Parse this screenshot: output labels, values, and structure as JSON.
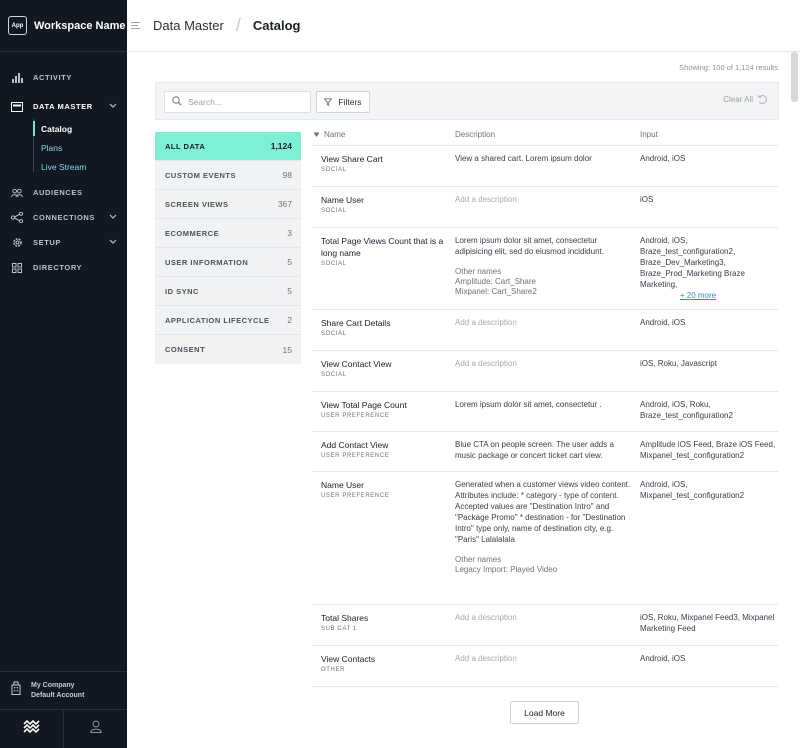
{
  "workspace": {
    "logo_text": "App",
    "name": "Workspace Name"
  },
  "nav": {
    "activity": "ACTIVITY",
    "data_master": "DATA MASTER",
    "sub": [
      "Catalog",
      "Plans",
      "Live Stream"
    ],
    "audiences": "AUDIENCES",
    "connections": "CONNECTIONS",
    "setup": "SETUP",
    "directory": "DIRECTORY"
  },
  "company": {
    "line1": "My Company",
    "line2": "Default Account"
  },
  "breadcrumb": {
    "parent": "Data Master",
    "current": "Catalog"
  },
  "showing": "Showing: 100 of 1,124 results",
  "search": {
    "placeholder": "Search..."
  },
  "filters_label": "Filters",
  "clear_all": "Clear All",
  "categories": [
    {
      "label": "ALL DATA",
      "count": "1,124"
    },
    {
      "label": "CUSTOM EVENTS",
      "count": "98"
    },
    {
      "label": "SCREEN VIEWS",
      "count": "367"
    },
    {
      "label": "ECOMMERCE",
      "count": "3"
    },
    {
      "label": "USER INFORMATION",
      "count": "5"
    },
    {
      "label": "ID SYNC",
      "count": "5"
    },
    {
      "label": "APPLICATION LIFECYCLE",
      "count": "2"
    },
    {
      "label": "CONSENT",
      "count": "15"
    }
  ],
  "table": {
    "headers": {
      "name": "Name",
      "description": "Description",
      "input": "Input"
    },
    "rows": [
      {
        "name": "View Share Cart",
        "tag": "SOCIAL",
        "desc": "View a shared cart. Lorem ipsum dolor",
        "input": "Android, iOS"
      },
      {
        "name": "Name User",
        "tag": "SOCIAL",
        "desc": "Add a description",
        "input": "iOS"
      },
      {
        "name": "Total Page Views Count that is a long name",
        "tag": "SOCIAL",
        "desc": "Lorem ipsum dolor sit amet, consectetur adipisicing elit, sed do eiusmod incididunt.",
        "other_title": "Other names",
        "other": [
          "Amplitude: Cart_Share",
          "Mixpanel: Cart_Share2"
        ],
        "input": "Android, iOS, Braze_test_configuration2, Braze_Dev_Marketing3, Braze_Prod_Marketing Braze Marketing,",
        "more": "+ 20 more"
      },
      {
        "name": "Share Cart Details",
        "tag": "SOCIAL",
        "desc": "Add a description",
        "input": "Android, iOS"
      },
      {
        "name": "View Contact View",
        "tag": "SOCIAL",
        "desc": "Add a description",
        "input": "iOS, Roku, Javascript"
      },
      {
        "name": "View Total Page Count",
        "tag": "USER PREFERENCE",
        "desc": "Lorem ipsum dolor sit amet, consectetur .",
        "input": "Android, iOS, Roku, Braze_test_configuration2"
      },
      {
        "name": "Add Contact View",
        "tag": "USER PREFERENCE",
        "desc": "Blue CTA on people screen. The user adds a music package or concert ticket cart view.",
        "input": "Amplitude iOS Feed, Braze iOS Feed, Mixpanel_test_configuration2"
      },
      {
        "name": "Name User",
        "tag": "USER PREFERENCE",
        "desc": "Generated when a customer views video content. Attributes include: * category - type of content. Accepted values are \"Destination Intro\" and \"Package Promo\" * destination - for \"Destination Intro\" type only, name of destination city, e.g. \"Paris\" Lalalalala",
        "other_title": "Other names",
        "other": [
          "Legacy Import: Played Video"
        ],
        "input": "Android, iOS, Mixpanel_test_configuration2"
      },
      {
        "name": "Total Shares",
        "tag": "SUB CAT 1",
        "desc": "Add a description",
        "input": "iOS, Roku, Mixpanel Feed3, Mixpanel Marketing Feed"
      },
      {
        "name": "View Contacts",
        "tag": "OTHER",
        "desc": "Add a description",
        "input": "Android, iOS"
      }
    ]
  },
  "load_more": "Load More"
}
